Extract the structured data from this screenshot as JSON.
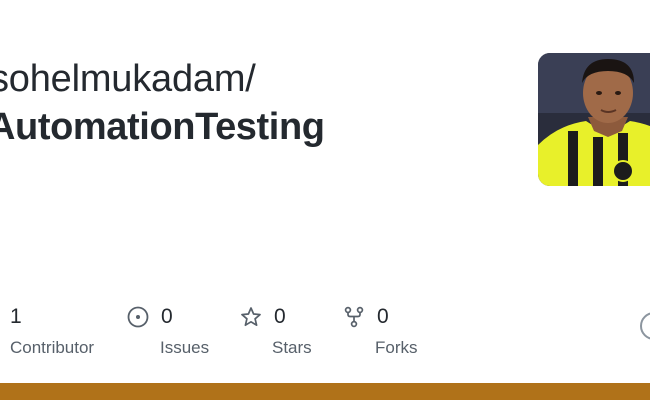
{
  "repo": {
    "owner": "sohelmukadam/",
    "name": "AutomationTesting"
  },
  "stats": {
    "contributors": {
      "count": "1",
      "label": "Contributor"
    },
    "issues": {
      "count": "0",
      "label": "Issues"
    },
    "stars": {
      "count": "0",
      "label": "Stars"
    },
    "forks": {
      "count": "0",
      "label": "Forks"
    }
  },
  "icons": {
    "issues": "issue-opened-icon",
    "stars": "star-icon",
    "forks": "repo-forked-icon",
    "github": "github-mark-icon"
  },
  "colors": {
    "language_bar": "#b07219",
    "text_primary": "#24292f",
    "text_secondary": "#57606a"
  }
}
